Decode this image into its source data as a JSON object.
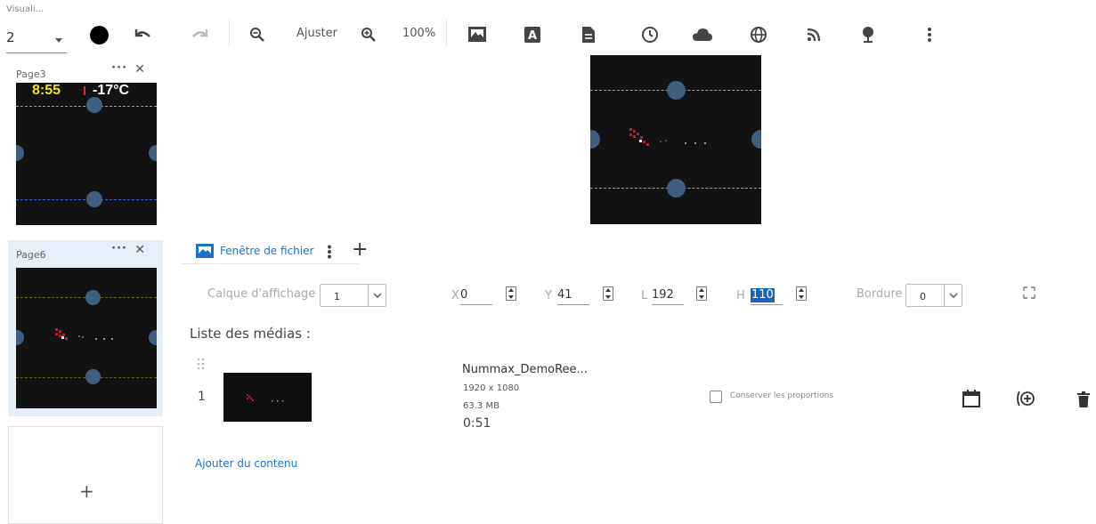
{
  "toolbar": {
    "visual_label": "Visuali...",
    "visual_value": "2",
    "fit_label": "Ajuster",
    "zoom_level": "100%"
  },
  "pages": [
    {
      "name": "Page3",
      "time": "8:55",
      "temp": "-17°C"
    },
    {
      "name": "Page6"
    }
  ],
  "add_page": "+",
  "panel": {
    "tab_label": "Fenêtre de fichier",
    "add_tab": "+",
    "layer_label": "Calque d'affichage",
    "layer_value": "1",
    "x_label": "X",
    "x_value": "0",
    "y_label": "Y",
    "y_value": "41",
    "w_label": "L",
    "w_value": "192",
    "h_label": "H",
    "h_value": "110",
    "border_label": "Bordure",
    "border_value": "0",
    "media_list_title": "Liste des médias :",
    "media": [
      {
        "index": "1",
        "name": "Nummax_DemoRee...",
        "resolution": "1920 x 1080",
        "size": "63.3 MB",
        "duration": "0:51"
      }
    ],
    "keep_ratio_label": "Conserver les proportions",
    "add_content": "Ajouter du contenu"
  },
  "colors": {
    "accent": "#1a73c9",
    "selection": "#1565c0",
    "screen_bg": "#121212",
    "circle": "#3f5f80",
    "dash_yellow": "#b8a640",
    "dash_blue": "#3b5bd0",
    "page_active_bg": "#e6eefa"
  }
}
